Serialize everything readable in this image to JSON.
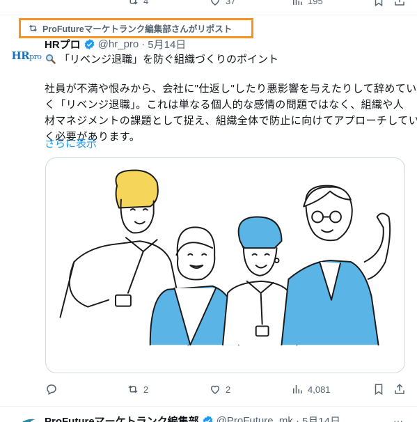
{
  "prev_actions": {
    "retweets": "4",
    "likes": "37",
    "views": "195"
  },
  "repost": {
    "label": "ProFutureマーケトランク編集部さんがリポスト"
  },
  "post": {
    "avatar_logo": "HR",
    "avatar_logo_small": "pro",
    "author_name": "HRプロ",
    "handle": "@hr_pro",
    "separator": "·",
    "date": "5月14日",
    "headline": "「リベンジ退職」を防ぐ組織づくりのポイント",
    "body_lines": [
      "社員が不満や恨みから、会社に\"仕返し\"したり悪影響を与えたりして辞めてい",
      "く「リベンジ退職」。これは単なる個人的な感情の問題ではなく、組織や人",
      "材マネジメントの課題として捉え、組織全体で防止に向けてアプローチしてい",
      "く必要があります。"
    ],
    "more_link": "さらに表示",
    "actions": {
      "replies": "",
      "retweets": "2",
      "likes": "2",
      "views": "4,081"
    }
  },
  "next_post": {
    "author_name": "ProFutureマーケトランク編集部",
    "handle": "@ProFuture_mk",
    "separator": "·",
    "date": "5月14日"
  },
  "colors": {
    "accent": "#1d9bf0",
    "banner_border": "#f7931e",
    "muted": "#536471",
    "illustration_blue": "#5ab4e5",
    "illustration_yellow": "#f5d55a"
  }
}
